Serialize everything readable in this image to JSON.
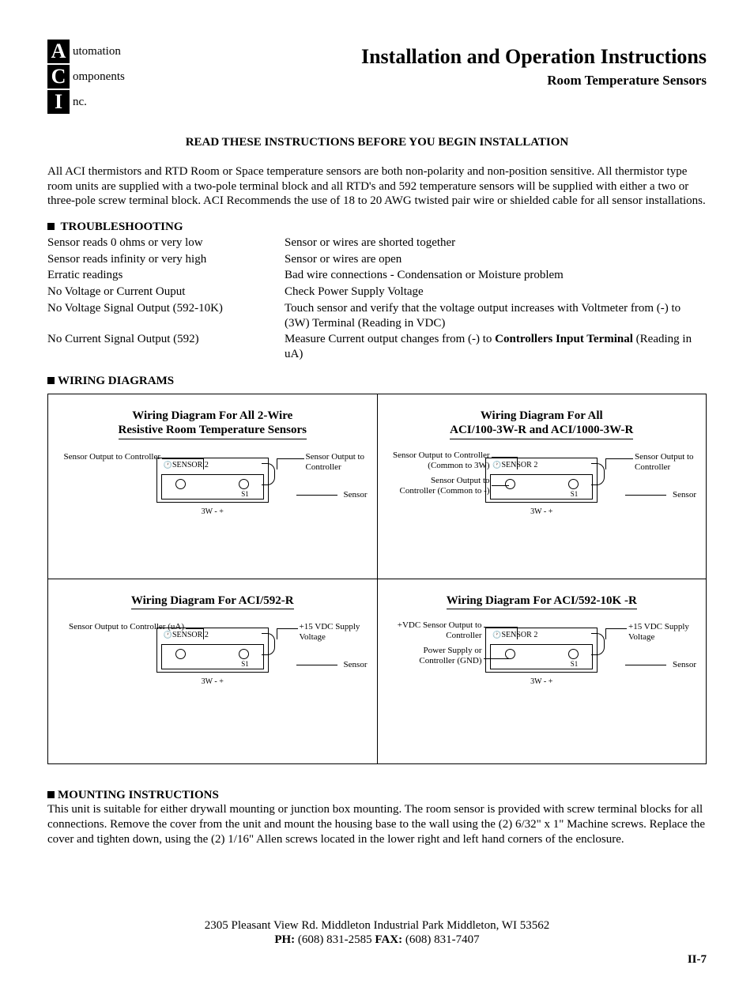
{
  "logo": {
    "a": "A",
    "a_rest": "utomation",
    "c": "C",
    "c_rest": "omponents",
    "i": "I",
    "i_rest": "nc."
  },
  "title": {
    "main": "Installation and Operation Instructions",
    "sub": "Room Temperature Sensors"
  },
  "read_line": "READ THESE INSTRUCTIONS BEFORE YOU BEGIN INSTALLATION",
  "intro": "All ACI thermistors and RTD Room or Space temperature sensors are both non-polarity and non-position sensitive.  All thermistor type room units are supplied with a two-pole terminal block and all RTD's and 592 temperature sensors will be supplied with either a two or three-pole screw terminal block.  ACI Recommends the use of 18 to 20 AWG twisted pair wire or shielded cable for all sensor installations.",
  "sections": {
    "troubleshooting": "TROUBLESHOOTING",
    "wiring": "WIRING DIAGRAMS",
    "mounting": "MOUNTING  INSTRUCTIONS"
  },
  "troubleshoot": {
    "r1p": "Sensor reads 0 ohms or very low",
    "r1s": "Sensor or wires are shorted together",
    "r2p": "Sensor reads infinity or very high",
    "r2s": "Sensor or wires are open",
    "r3p": "Erratic readings",
    "r3s": "Bad wire connections - Condensation or Moisture problem",
    "r4p": "No Voltage or Current Ouput",
    "r4s": "Check Power Supply Voltage",
    "r5p": "No Voltage Signal Output (592-10K)",
    "r5s": "Touch sensor and verify that the voltage output increases with Voltmeter from (-) to (3W) Terminal (Reading in VDC)",
    "r6p": "No Current Signal Output (592)",
    "r6s_pre": "Measure Current output changes from (-) to ",
    "r6s_bold": "Controllers Input Terminal",
    "r6s_post": " (Reading in uA)"
  },
  "diag": {
    "d1": {
      "t1": "Wiring Diagram For All 2-Wire",
      "t2": "Resistive Room Temperature Sensors",
      "ll1": "Sensor Output to Controller",
      "rl1": "Sensor Output to",
      "rl2": "Controller",
      "rl3": "Sensor"
    },
    "d2": {
      "t1": "Wiring Diagram For All",
      "t2": "ACI/100-3W-R and ACI/1000-3W-R",
      "ll1": "Sensor Output to Controller",
      "ll1b": "(Common to 3W)",
      "ll2": "Sensor Output to",
      "ll2b": "Controller (Common to -)",
      "rl1": "Sensor Output to",
      "rl2": "Controller",
      "rl3": "Sensor"
    },
    "d3": {
      "t1": "Wiring Diagram For ACI/592-R",
      "ll1": "Sensor Output to Controller (uA)",
      "rl1": "+15 VDC Supply",
      "rl2": "Voltage",
      "rl3": "Sensor"
    },
    "d4": {
      "t1": "Wiring Diagram For ACI/592-10K -R",
      "ll1": "+VDC Sensor Output to",
      "ll1b": "Controller",
      "ll2": "Power Supply or",
      "ll2b": "Controller (GND)",
      "rl1": "+15 VDC Supply",
      "rl2": "Voltage",
      "rl3": "Sensor"
    },
    "common": {
      "sensor2": "SENSOR 2",
      "s1": "S1",
      "bottom": "3W  -    +",
      "clock": "🕐"
    }
  },
  "mounting_text": "This unit is suitable for either drywall mounting or junction box mounting.  The room sensor is provided with screw terminal blocks for all connections.  Remove the cover from the unit and mount the housing base to the wall using the (2) 6/32\" x 1\" Machine screws.  Replace the cover and tighten down, using the (2) 1/16\" Allen screws located in the lower right and left hand corners of the enclosure.",
  "footer": {
    "addr": "2305 Pleasant View Rd.     Middleton Industrial Park     Middleton, WI 53562",
    "ph_l": "PH:",
    "ph": " (608) 831-2585     ",
    "fx_l": "FAX:",
    "fx": " (608) 831-7407",
    "page": "II-7"
  }
}
